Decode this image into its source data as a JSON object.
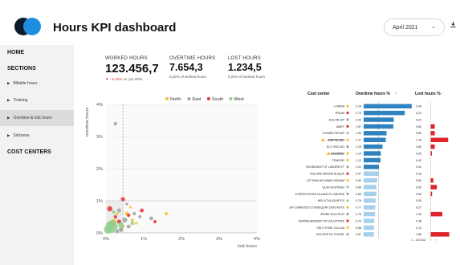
{
  "header": {
    "title": "Hours KPI dashboard",
    "date_selected": "April 2021",
    "logo_colors": [
      "#0d1a2b",
      "#1f8ee0"
    ]
  },
  "sidebar": {
    "home": "HOME",
    "sections_title": "SECTIONS",
    "items": [
      {
        "label": "Billable hours",
        "active": false
      },
      {
        "label": "Training",
        "active": false
      },
      {
        "label": "Overtime & lost hours",
        "active": true
      },
      {
        "label": "Sickness",
        "active": false
      }
    ],
    "cost_centers_title": "COST CENTERS"
  },
  "kpis": {
    "worked": {
      "label": "WORKED HOURS",
      "value": "123.456,7",
      "delta": "▼ - 5,20%",
      "delta_ref": "vs. jun 2021"
    },
    "overtime": {
      "label": "OVERTIME HOURS",
      "value": "7.654,3",
      "sub": "6,25% of worked hours"
    },
    "lost": {
      "label": "LOST HOURS",
      "value": "1.234,5",
      "sub": "0,22% of worked hours"
    }
  },
  "colors": {
    "north": "#f2c230",
    "east": "#a0a0a0",
    "south": "#e0312f",
    "west": "#8fd08a",
    "overtime_bar": "#2f83c0",
    "overtime_bar_light": "#a6d1ec",
    "lost_bar": "#e0242c",
    "warning": "#f2b21c"
  },
  "chart_data": [
    {
      "type": "scatter",
      "xlabel": "lost hours",
      "ylabel": "overtime hours",
      "xlim": [
        0,
        4
      ],
      "ylim": [
        0,
        4
      ],
      "x_ticks": [
        "0%",
        "1%",
        "2%",
        "3%",
        "4%"
      ],
      "y_ticks": [
        "0%",
        "1%",
        "2%",
        "3%",
        "4%"
      ],
      "legend": [
        "North",
        "East",
        "South",
        "West"
      ],
      "legend_placement": "top-right",
      "series": [
        {
          "name": "North",
          "color": "#f2c230",
          "points": [
            [
              0.2,
              0.35,
              3.5
            ],
            [
              0.55,
              0.6,
              2.5
            ],
            [
              0.7,
              0.4,
              2
            ],
            [
              0.45,
              0.2,
              2
            ],
            [
              0.3,
              0.6,
              1.8
            ],
            [
              1.6,
              0.6,
              2.2
            ],
            [
              0.8,
              0.3,
              1.8
            ],
            [
              0.65,
              0.8,
              1.6
            ]
          ]
        },
        {
          "name": "East",
          "color": "#a0a0a0",
          "points": [
            [
              0.25,
              3.4,
              2.2
            ],
            [
              0.15,
              0.25,
              4.5
            ],
            [
              0.5,
              0.4,
              3
            ],
            [
              0.35,
              0.7,
              2.5
            ],
            [
              0.6,
              0.2,
              2.4
            ],
            [
              0.4,
              0.1,
              2.8
            ],
            [
              0.75,
              0.6,
              2.2
            ],
            [
              1.2,
              0.45,
              2.4
            ],
            [
              0.3,
              0.05,
              2
            ],
            [
              0.55,
              0.9,
              1.8
            ],
            [
              0.9,
              0.5,
              2
            ]
          ]
        },
        {
          "name": "South",
          "color": "#e0312f",
          "points": [
            [
              0.45,
              1.05,
              2.6
            ],
            [
              0.1,
              0.75,
              3.2
            ],
            [
              0.35,
              0.35,
              2.6
            ],
            [
              0.6,
              0.55,
              2.2
            ],
            [
              0.95,
              0.7,
              2.4
            ],
            [
              0.25,
              0.5,
              2.2
            ],
            [
              1.3,
              0.35,
              2
            ]
          ]
        },
        {
          "name": "West",
          "color": "#8fd08a",
          "points": [
            [
              0.15,
              0.2,
              7.5
            ],
            [
              0.05,
              0.1,
              5
            ],
            [
              0.4,
              0.25,
              3.5
            ],
            [
              0.7,
              0.3,
              2.4
            ],
            [
              0.2,
              0.65,
              2.2
            ]
          ]
        }
      ],
      "reference_lines": {
        "x": 0.45,
        "y": 1.0
      },
      "highlight_region": "x < 0.45 and y < 1.0"
    },
    {
      "type": "bar",
      "title": "Overtime hours %",
      "columns": [
        "Cost center",
        "Overtime hours %",
        "Lost hours %"
      ],
      "categories": [
        "LOREM",
        "IPSUM",
        "DOLOR SIT",
        "AMET",
        "CONSECTETUR",
        "ADIPISCING",
        "ELIT SED DO",
        "EIUSMOD",
        "TEMPOR",
        "INCIDIDUNT UT LABORE ET",
        "DOLORE MAGNA ALIQUA",
        "UT ENIM AD MINIM VENIAM",
        "QUIS NOSTRUD",
        "EXERCITATION ULLAMCO LABORIS",
        "NISI UT ALIQUIP EX",
        "EA COMMODO CONSEQUAT DUIS AUTE",
        "IRURE DOLOR IN",
        "REPREHENDERIT IN VOLUPTATE",
        "VELIT ESSE CILLUM",
        "DOLORE EU FUGIAT"
      ],
      "overtime_values": [
        "3.19",
        "2.73",
        "2.00",
        "1.97",
        "1.52",
        "1.47",
        "1.25",
        "1.14",
        "1.12",
        "1.01",
        "0.97",
        "0.90",
        "0.85",
        "0.85",
        "0.79",
        "0.77",
        "0.76",
        "0.70",
        "0.68",
        "0.67"
      ],
      "lost_values": [
        "0.40",
        "0.24",
        "0.20",
        "0.80",
        "0.80",
        "1.78",
        "0.80",
        "0.59",
        "0.43",
        "0.41",
        "0.26",
        "0.69",
        "0.95",
        "0.60",
        "0.40",
        "0.27",
        "1.35",
        "0.48",
        "0.13",
        "1.86"
      ],
      "region_colors": [
        "#f2c230",
        "#e0312f",
        "#a0a0a0",
        "#e0312f",
        "#8fd08a",
        "#f2c230",
        "#a0a0a0",
        "#f2c230",
        "#f2c230",
        "#a0a0a0",
        "#e0312f",
        "#f2c230",
        "#8fd08a",
        "#a0a0a0",
        "#8fd08a",
        "#f2c230",
        "#a0a0a0",
        "#e0312f",
        "#f2c230",
        "#a0a0a0"
      ],
      "warning_rows": [
        5,
        7
      ],
      "overtime_threshold": 1.0,
      "lost_threshold": 0.5,
      "overtime_max": 3.2,
      "lost_max": 2.0,
      "sort_indicator": "↑",
      "lost_sort_indicator": "↕",
      "pager": "1 - 20/152"
    }
  ]
}
